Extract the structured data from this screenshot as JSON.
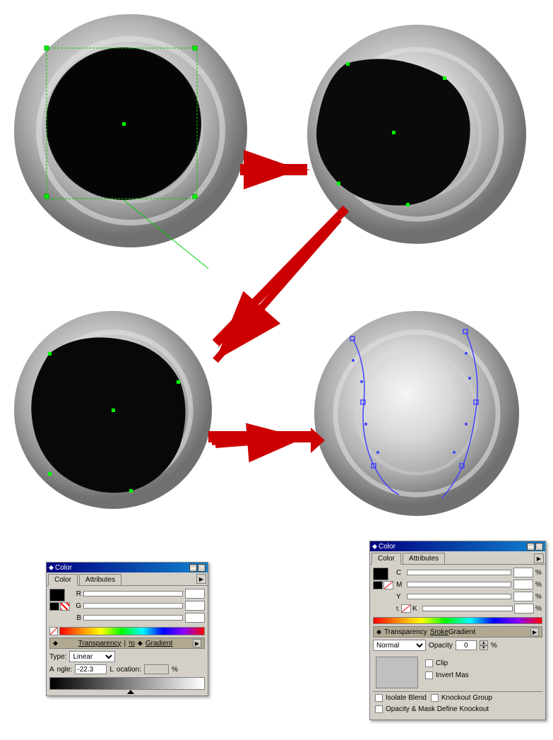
{
  "canvas": {
    "background": "#ffffff"
  },
  "panel_left": {
    "titlebar": "Color",
    "close_btn": "✕",
    "collapse_btn": "▼",
    "tabs": [
      "Color",
      "Attributes"
    ],
    "active_tab": "Color",
    "r_label": "R",
    "g_label": "G",
    "b_label": "B",
    "r_value": "",
    "g_value": "",
    "b_value": "",
    "transparency_section": "Transparency",
    "gradient_section": "Gradient",
    "type_label": "Type:",
    "type_value": "Linear",
    "angle_label": "ngle:",
    "angle_value": "-22.3",
    "location_label": "ocation:",
    "location_value": "",
    "percent_label": "%"
  },
  "panel_right": {
    "titlebar": "Color",
    "tabs": [
      "Color",
      "Attributes"
    ],
    "active_tab": "Color",
    "c_label": "C",
    "m_label": "M",
    "y_label": "Y",
    "k_label": "K",
    "c_value": "",
    "m_value": "",
    "y_value": "",
    "k_value": "",
    "percent_sign": "%",
    "transparency_label": "Transparency",
    "stroke_label": "roke",
    "gradient_label": "dient",
    "blend_mode": "Normal",
    "opacity_label": "Opacity",
    "opacity_value": "0",
    "clip_label": "Clip",
    "invert_label": "Invert Mas",
    "isolate_label": "Isolate Blend",
    "knockout_label": "Knockout Group",
    "opacity_mask_label": "Opacity & Mask Define Knockout"
  }
}
